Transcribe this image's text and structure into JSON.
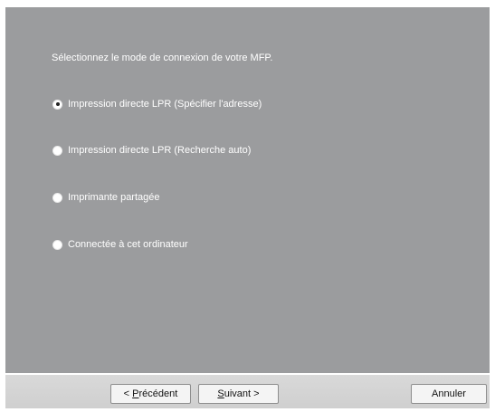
{
  "dialog": {
    "prompt": "Sélectionnez le mode de connexion de votre MFP.",
    "options": [
      {
        "label": "Impression directe LPR (Spécifier l'adresse)",
        "selected": true
      },
      {
        "label": "Impression directe LPR (Recherche auto)",
        "selected": false
      },
      {
        "label": "Imprimante partagée",
        "selected": false
      },
      {
        "label": "Connectée à cet ordinateur",
        "selected": false
      }
    ]
  },
  "buttons": {
    "back": {
      "prefix": "< ",
      "mnemonic": "P",
      "rest": "récédent"
    },
    "next": {
      "mnemonic": "S",
      "rest": "uivant",
      "suffix": " >"
    },
    "cancel": "Annuler"
  },
  "colors": {
    "panel": "#9b9c9e",
    "text": "#ffffff",
    "footer": "#d4d4d4"
  }
}
